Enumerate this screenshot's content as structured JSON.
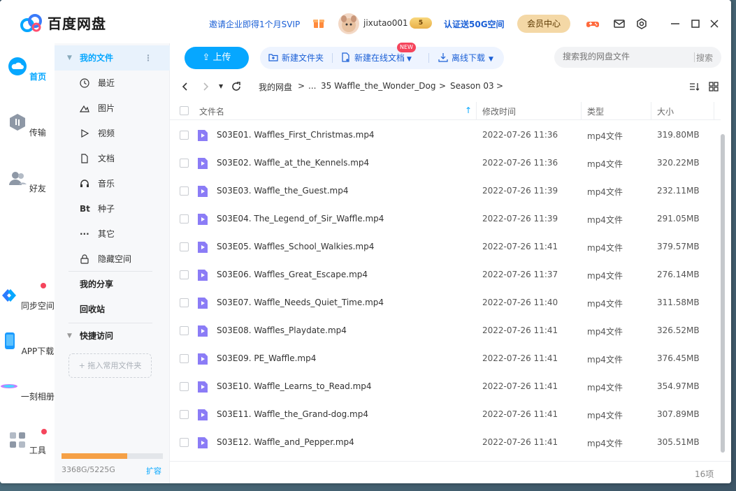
{
  "app": {
    "logo_text": "百度网盘",
    "invite_text": "邀请企业即得1个月SVIP",
    "username": "jixutao001",
    "vip_badge": "5",
    "verify_text": "认证送50G空间",
    "member_center": "会员中心"
  },
  "rail": [
    {
      "label": "首页",
      "icon": "home-cloud-icon",
      "active": true
    },
    {
      "label": "传输",
      "icon": "transfer-icon"
    },
    {
      "label": "好友",
      "icon": "friends-icon"
    },
    {
      "label": "同步空间",
      "icon": "sync-space-icon"
    },
    {
      "label": "APP下载",
      "icon": "app-download-icon"
    },
    {
      "label": "一刻相册",
      "icon": "album-icon"
    },
    {
      "label": "工具",
      "icon": "tools-icon"
    }
  ],
  "folders": {
    "my_files": "我的文件",
    "items": [
      {
        "label": "最近",
        "icon": "clock-icon"
      },
      {
        "label": "图片",
        "icon": "image-icon"
      },
      {
        "label": "视频",
        "icon": "video-icon"
      },
      {
        "label": "文档",
        "icon": "document-icon"
      },
      {
        "label": "音乐",
        "icon": "music-icon"
      },
      {
        "label": "种子",
        "icon": "torrent-icon"
      },
      {
        "label": "其它",
        "icon": "more-icon"
      },
      {
        "label": "隐藏空间",
        "icon": "lock-icon"
      }
    ],
    "my_share": "我的分享",
    "recycle": "回收站",
    "quick_access": "快捷访问",
    "drop_hint": "+ 拖入常用文件夹",
    "quota_text": "3368G/5225G",
    "quota_fraction": 0.645,
    "expand": "扩容"
  },
  "toolbar": {
    "upload": "上传",
    "new_folder": "新建文件夹",
    "new_online_doc": "新建在线文档",
    "new_tag": "NEW",
    "offline_download": "离线下载",
    "search_placeholder": "搜索我的网盘文件",
    "search_button": "搜索"
  },
  "breadcrumb": {
    "root": "我的网盘",
    "sep": ">",
    "ellipsis": "...",
    "folder1": "35 Waffle_the_Wonder_Dog",
    "folder2": "Season 03"
  },
  "table": {
    "headers": {
      "name": "文件名",
      "modified": "修改时间",
      "type": "类型",
      "size": "大小"
    },
    "rows": [
      {
        "name": "S03E01. Waffles_First_Christmas.mp4",
        "time": "2022-07-26 11:36",
        "type": "mp4文件",
        "size": "319.80MB"
      },
      {
        "name": "S03E02. Waffle_at_the_Kennels.mp4",
        "time": "2022-07-26 11:36",
        "type": "mp4文件",
        "size": "320.22MB"
      },
      {
        "name": "S03E03. Waffle_the_Guest.mp4",
        "time": "2022-07-26 11:39",
        "type": "mp4文件",
        "size": "232.11MB"
      },
      {
        "name": "S03E04. The_Legend_of_Sir_Waffle.mp4",
        "time": "2022-07-26 11:39",
        "type": "mp4文件",
        "size": "291.05MB"
      },
      {
        "name": "S03E05. Waffles_School_Walkies.mp4",
        "time": "2022-07-26 11:41",
        "type": "mp4文件",
        "size": "379.57MB"
      },
      {
        "name": "S03E06. Waffles_Great_Escape.mp4",
        "time": "2022-07-26 11:37",
        "type": "mp4文件",
        "size": "276.14MB"
      },
      {
        "name": "S03E07. Waffle_Needs_Quiet_Time.mp4",
        "time": "2022-07-26 11:40",
        "type": "mp4文件",
        "size": "311.58MB"
      },
      {
        "name": "S03E08. Waffles_Playdate.mp4",
        "time": "2022-07-26 11:41",
        "type": "mp4文件",
        "size": "326.52MB"
      },
      {
        "name": "S03E09. PE_Waffle.mp4",
        "time": "2022-07-26 11:41",
        "type": "mp4文件",
        "size": "376.45MB"
      },
      {
        "name": "S03E10. Waffle_Learns_to_Read.mp4",
        "time": "2022-07-26 11:41",
        "type": "mp4文件",
        "size": "354.97MB"
      },
      {
        "name": "S03E11. Waffle_the_Grand-dog.mp4",
        "time": "2022-07-26 11:41",
        "type": "mp4文件",
        "size": "307.89MB"
      },
      {
        "name": "S03E12. Waffle_and_Pepper.mp4",
        "time": "2022-07-26 11:41",
        "type": "mp4文件",
        "size": "305.51MB"
      }
    ],
    "count": "16项"
  },
  "colors": {
    "accent": "#06a7ff",
    "link": "#1a5fd6",
    "file_icon": "#8b7cf6",
    "quota": "#f5a046",
    "badge": "#f5455c"
  }
}
